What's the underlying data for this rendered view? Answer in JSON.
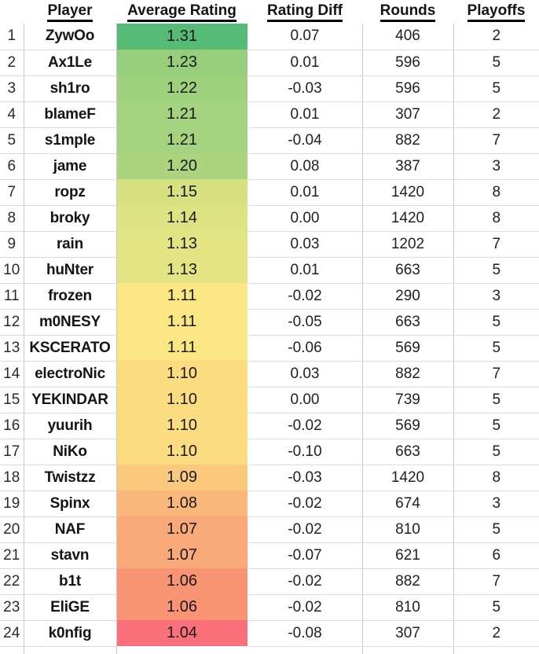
{
  "table": {
    "columns": [
      {
        "key": "rownum",
        "label": "",
        "blank": true
      },
      {
        "key": "player",
        "label": "Player"
      },
      {
        "key": "rating",
        "label": "Average Rating"
      },
      {
        "key": "diff",
        "label": "Rating Diff"
      },
      {
        "key": "rounds",
        "label": "Rounds"
      },
      {
        "key": "playoffs",
        "label": "Playoffs"
      }
    ],
    "rows": [
      {
        "rownum": "1",
        "player": "ZywOo",
        "rating": "1.31",
        "diff": "0.07",
        "rounds": "406",
        "playoffs": "2",
        "rating_color": "#57BB78"
      },
      {
        "rownum": "2",
        "player": "Ax1Le",
        "rating": "1.23",
        "diff": "0.01",
        "rounds": "596",
        "playoffs": "5",
        "rating_color": "#97CE7C"
      },
      {
        "rownum": "3",
        "player": "sh1ro",
        "rating": "1.22",
        "diff": "-0.03",
        "rounds": "596",
        "playoffs": "5",
        "rating_color": "#9ED07D"
      },
      {
        "rownum": "4",
        "player": "blameF",
        "rating": "1.21",
        "diff": "0.01",
        "rounds": "307",
        "playoffs": "2",
        "rating_color": "#A5D27E"
      },
      {
        "rownum": "5",
        "player": "s1mple",
        "rating": "1.21",
        "diff": "-0.04",
        "rounds": "882",
        "playoffs": "7",
        "rating_color": "#A5D27E"
      },
      {
        "rownum": "6",
        "player": "jame",
        "rating": "1.20",
        "diff": "0.08",
        "rounds": "387",
        "playoffs": "3",
        "rating_color": "#ACD47F"
      },
      {
        "rownum": "7",
        "player": "ropz",
        "rating": "1.15",
        "diff": "0.01",
        "rounds": "1420",
        "playoffs": "8",
        "rating_color": "#D7E182"
      },
      {
        "rownum": "8",
        "player": "broky",
        "rating": "1.14",
        "diff": "0.00",
        "rounds": "1420",
        "playoffs": "8",
        "rating_color": "#DDE383"
      },
      {
        "rownum": "9",
        "player": "rain",
        "rating": "1.13",
        "diff": "0.03",
        "rounds": "1202",
        "playoffs": "7",
        "rating_color": "#E3E584"
      },
      {
        "rownum": "10",
        "player": "huNter",
        "rating": "1.13",
        "diff": "0.01",
        "rounds": "663",
        "playoffs": "5",
        "rating_color": "#E3E584"
      },
      {
        "rownum": "11",
        "player": "frozen",
        "rating": "1.11",
        "diff": "-0.02",
        "rounds": "290",
        "playoffs": "3",
        "rating_color": "#FBE684"
      },
      {
        "rownum": "12",
        "player": "m0NESY",
        "rating": "1.11",
        "diff": "-0.05",
        "rounds": "663",
        "playoffs": "5",
        "rating_color": "#FBE684"
      },
      {
        "rownum": "13",
        "player": "KSCERATO",
        "rating": "1.11",
        "diff": "-0.06",
        "rounds": "569",
        "playoffs": "5",
        "rating_color": "#FBE684"
      },
      {
        "rownum": "14",
        "player": "electroNic",
        "rating": "1.10",
        "diff": "0.03",
        "rounds": "882",
        "playoffs": "7",
        "rating_color": "#FCDC81"
      },
      {
        "rownum": "15",
        "player": "YEKINDAR",
        "rating": "1.10",
        "diff": "0.00",
        "rounds": "739",
        "playoffs": "5",
        "rating_color": "#FCDC81"
      },
      {
        "rownum": "16",
        "player": "yuurih",
        "rating": "1.10",
        "diff": "-0.02",
        "rounds": "569",
        "playoffs": "5",
        "rating_color": "#FCDC81"
      },
      {
        "rownum": "17",
        "player": "NiKo",
        "rating": "1.10",
        "diff": "-0.10",
        "rounds": "663",
        "playoffs": "5",
        "rating_color": "#FCDC81"
      },
      {
        "rownum": "18",
        "player": "Twistzz",
        "rating": "1.09",
        "diff": "-0.03",
        "rounds": "1420",
        "playoffs": "8",
        "rating_color": "#FBC97D"
      },
      {
        "rownum": "19",
        "player": "Spinx",
        "rating": "1.08",
        "diff": "-0.02",
        "rounds": "674",
        "playoffs": "3",
        "rating_color": "#FAB97A"
      },
      {
        "rownum": "20",
        "player": "NAF",
        "rating": "1.07",
        "diff": "-0.02",
        "rounds": "810",
        "playoffs": "5",
        "rating_color": "#F9A877"
      },
      {
        "rownum": "21",
        "player": "stavn",
        "rating": "1.07",
        "diff": "-0.07",
        "rounds": "621",
        "playoffs": "6",
        "rating_color": "#F9A877"
      },
      {
        "rownum": "22",
        "player": "b1t",
        "rating": "1.06",
        "diff": "-0.02",
        "rounds": "882",
        "playoffs": "7",
        "rating_color": "#F89374"
      },
      {
        "rownum": "23",
        "player": "EliGE",
        "rating": "1.06",
        "diff": "-0.02",
        "rounds": "810",
        "playoffs": "5",
        "rating_color": "#F89374"
      },
      {
        "rownum": "24",
        "player": "k0nfig",
        "rating": "1.04",
        "diff": "-0.08",
        "rounds": "307",
        "playoffs": "2",
        "rating_color": "#F9707A"
      }
    ]
  },
  "chart_data": {
    "type": "table",
    "title": "Average Rating leaderboard",
    "columns": [
      "Player",
      "Average Rating",
      "Rating Diff",
      "Rounds",
      "Playoffs"
    ],
    "colorscale": {
      "applied_to": "Average Rating",
      "high_color": "#57BB78",
      "mid_color": "#FBE684",
      "low_color": "#F9707A",
      "high_value": 1.31,
      "low_value": 1.04
    },
    "rank": [
      1,
      2,
      3,
      4,
      5,
      6,
      7,
      8,
      9,
      10,
      11,
      12,
      13,
      14,
      15,
      16,
      17,
      18,
      19,
      20,
      21,
      22,
      23,
      24
    ],
    "players": [
      "ZywOo",
      "Ax1Le",
      "sh1ro",
      "blameF",
      "s1mple",
      "jame",
      "ropz",
      "broky",
      "rain",
      "huNter",
      "frozen",
      "m0NESY",
      "KSCERATO",
      "electroNic",
      "YEKINDAR",
      "yuurih",
      "NiKo",
      "Twistzz",
      "Spinx",
      "NAF",
      "stavn",
      "b1t",
      "EliGE",
      "k0nfig"
    ],
    "average_rating": [
      1.31,
      1.23,
      1.22,
      1.21,
      1.21,
      1.2,
      1.15,
      1.14,
      1.13,
      1.13,
      1.11,
      1.11,
      1.11,
      1.1,
      1.1,
      1.1,
      1.1,
      1.09,
      1.08,
      1.07,
      1.07,
      1.06,
      1.06,
      1.04
    ],
    "rating_diff": [
      0.07,
      0.01,
      -0.03,
      0.01,
      -0.04,
      0.08,
      0.01,
      0.0,
      0.03,
      0.01,
      -0.02,
      -0.05,
      -0.06,
      0.03,
      0.0,
      -0.02,
      -0.1,
      -0.03,
      -0.02,
      -0.02,
      -0.07,
      -0.02,
      -0.02,
      -0.08
    ],
    "rounds": [
      406,
      596,
      596,
      307,
      882,
      387,
      1420,
      1420,
      1202,
      663,
      290,
      663,
      569,
      882,
      739,
      569,
      663,
      1420,
      674,
      810,
      621,
      882,
      810,
      307
    ],
    "playoffs": [
      2,
      5,
      5,
      2,
      7,
      3,
      8,
      8,
      7,
      5,
      3,
      5,
      5,
      7,
      5,
      5,
      5,
      8,
      3,
      5,
      6,
      7,
      5,
      2
    ]
  }
}
